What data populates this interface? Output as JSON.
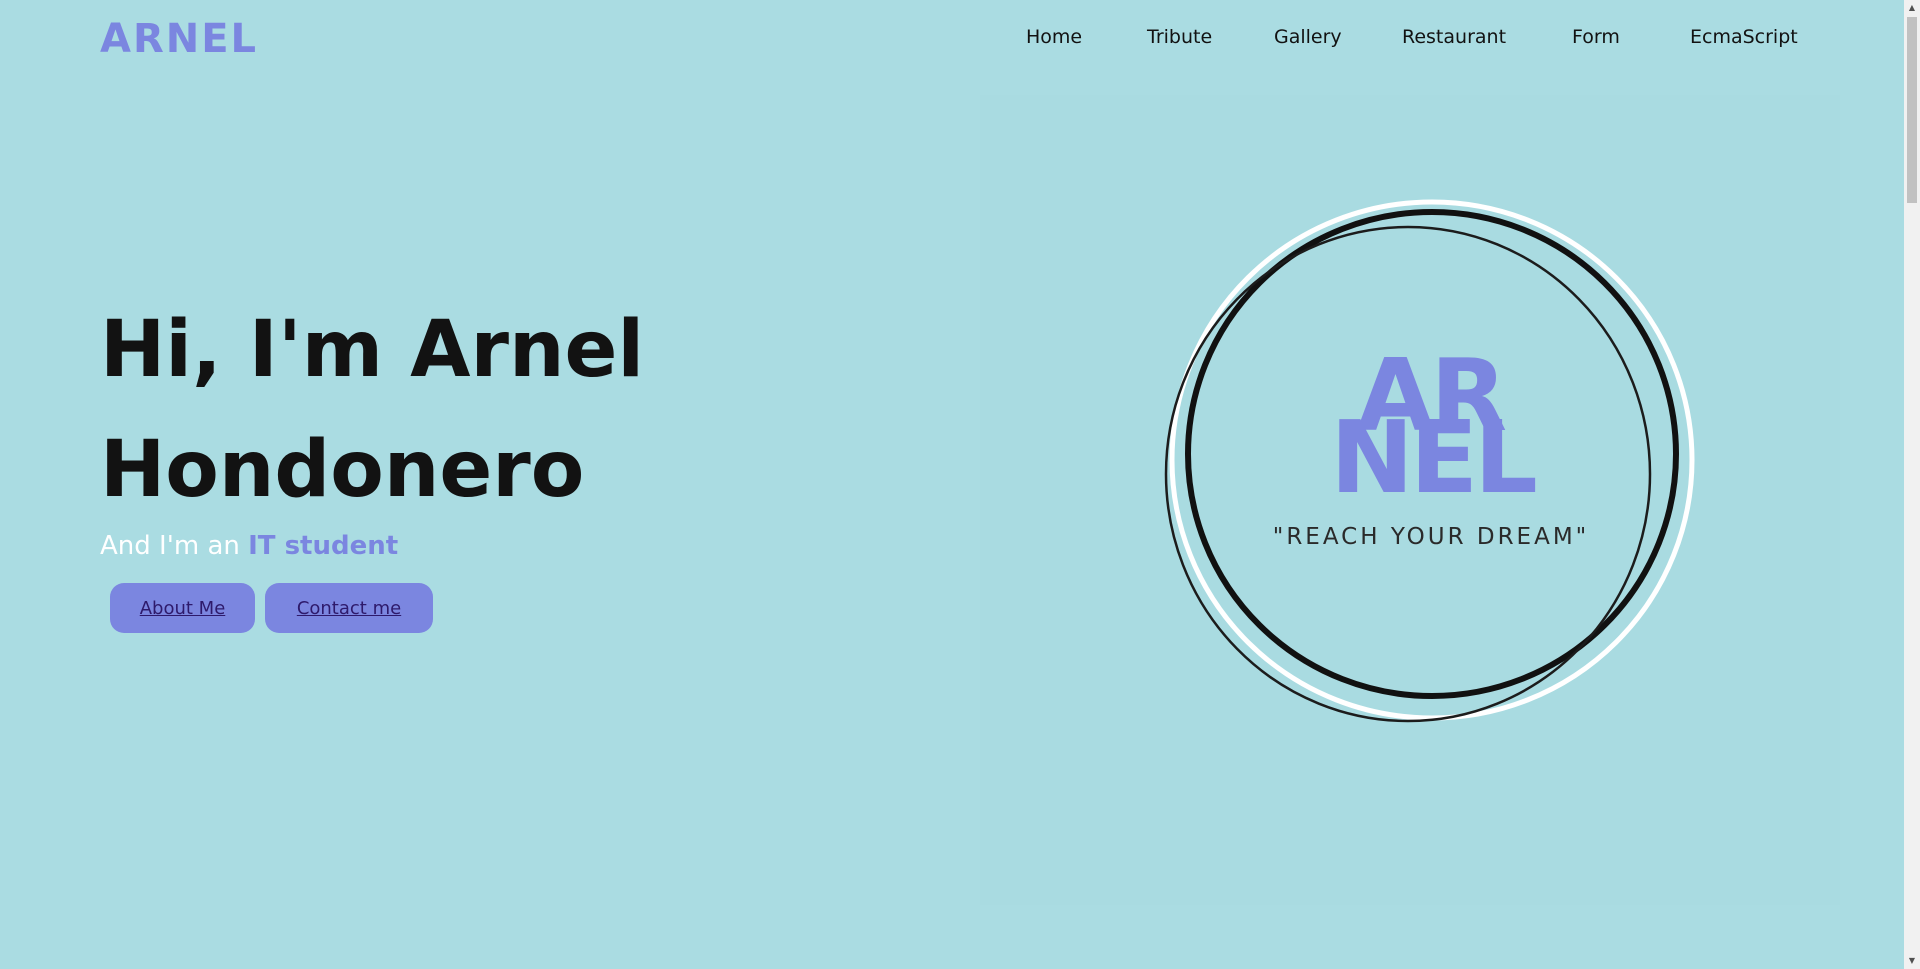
{
  "header": {
    "brand": "ARNEL",
    "nav": [
      "Home",
      "Tribute",
      "Gallery",
      "Restaurant",
      "Form",
      "EcmaScript"
    ]
  },
  "hero": {
    "title_line1": "Hi, I'm Arnel",
    "title_line2": "Hondonero",
    "subtitle_prefix": "And I'm an ",
    "subtitle_role": "IT student",
    "about_button": "About Me",
    "contact_button": "Contact me"
  },
  "logo": {
    "line1": "AR",
    "line2": "NEL",
    "tagline": "\"REACH YOUR DREAM\""
  },
  "colors": {
    "background": "#aadce2",
    "accent": "#7b86e0",
    "text": "#121212"
  },
  "scrollbar": {
    "up_icon": "chevron-up-icon",
    "down_icon": "chevron-down-icon"
  }
}
